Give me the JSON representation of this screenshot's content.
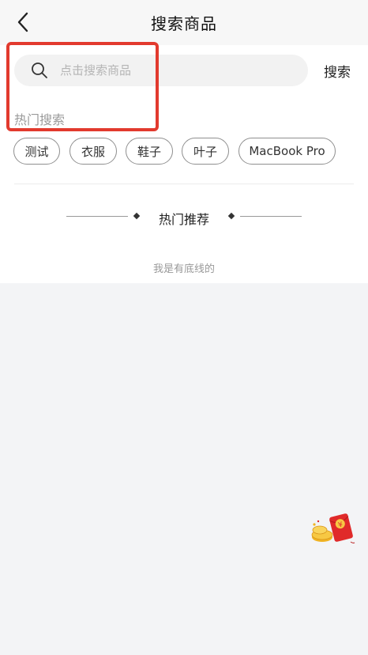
{
  "header": {
    "title": "搜索商品"
  },
  "search": {
    "placeholder": "点击搜索商品",
    "submit_label": "搜索"
  },
  "hot_search": {
    "label": "热门搜索",
    "tags": [
      "测试",
      "衣服",
      "鞋子",
      "叶子",
      "MacBook Pro"
    ]
  },
  "recommend": {
    "title": "热门推荐"
  },
  "footer": {
    "end_text": "我是有底线的"
  },
  "floating": {
    "icon": "red-packet-icon",
    "symbol": "¥"
  },
  "colors": {
    "highlight": "#e23a2e",
    "red_packet": "#e02a2a"
  }
}
